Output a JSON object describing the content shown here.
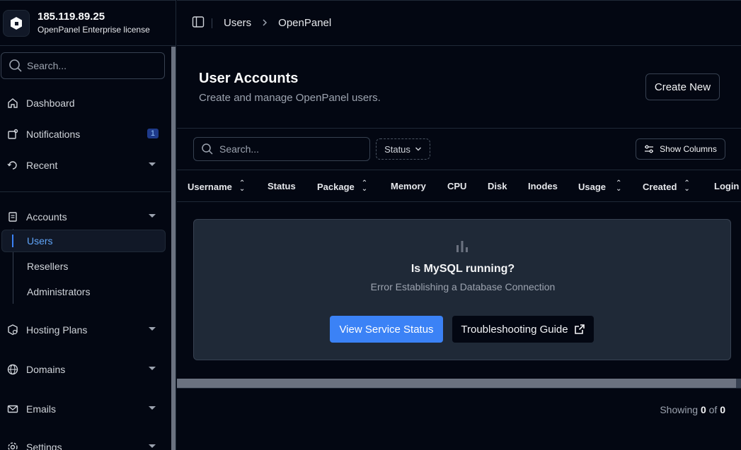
{
  "sidebar": {
    "ip": "185.119.89.25",
    "license": "OpenPanel Enterprise license",
    "search_placeholder": "Search...",
    "nav": {
      "dashboard": "Dashboard",
      "notifications": "Notifications",
      "notifications_badge": "1",
      "recent": "Recent",
      "accounts": "Accounts",
      "users": "Users",
      "resellers": "Resellers",
      "administrators": "Administrators",
      "hosting_plans": "Hosting Plans",
      "domains": "Domains",
      "emails": "Emails",
      "settings": "Settings"
    }
  },
  "breadcrumb": {
    "first": "Users",
    "second": "OpenPanel"
  },
  "page": {
    "title": "User Accounts",
    "subtitle": "Create and manage OpenPanel users.",
    "create_label": "Create New"
  },
  "toolbar": {
    "search_placeholder": "Search...",
    "status_label": "Status",
    "columns_label": "Show Columns"
  },
  "table": {
    "columns": [
      "Username",
      "Status",
      "Package",
      "Memory",
      "CPU",
      "Disk",
      "Inodes",
      "Usage",
      "Created",
      "Login"
    ]
  },
  "empty_state": {
    "title": "Is MySQL running?",
    "message": "Error Establishing a Database Connection",
    "primary_label": "View Service Status",
    "secondary_label": "Troubleshooting Guide"
  },
  "footer": {
    "showing_label": "Showing",
    "count": "0",
    "of_label": "of",
    "total": "0"
  },
  "colors": {
    "background": "#030712",
    "accent": "#3b82f6",
    "card": "#1f2937",
    "border": "#1f2937"
  }
}
